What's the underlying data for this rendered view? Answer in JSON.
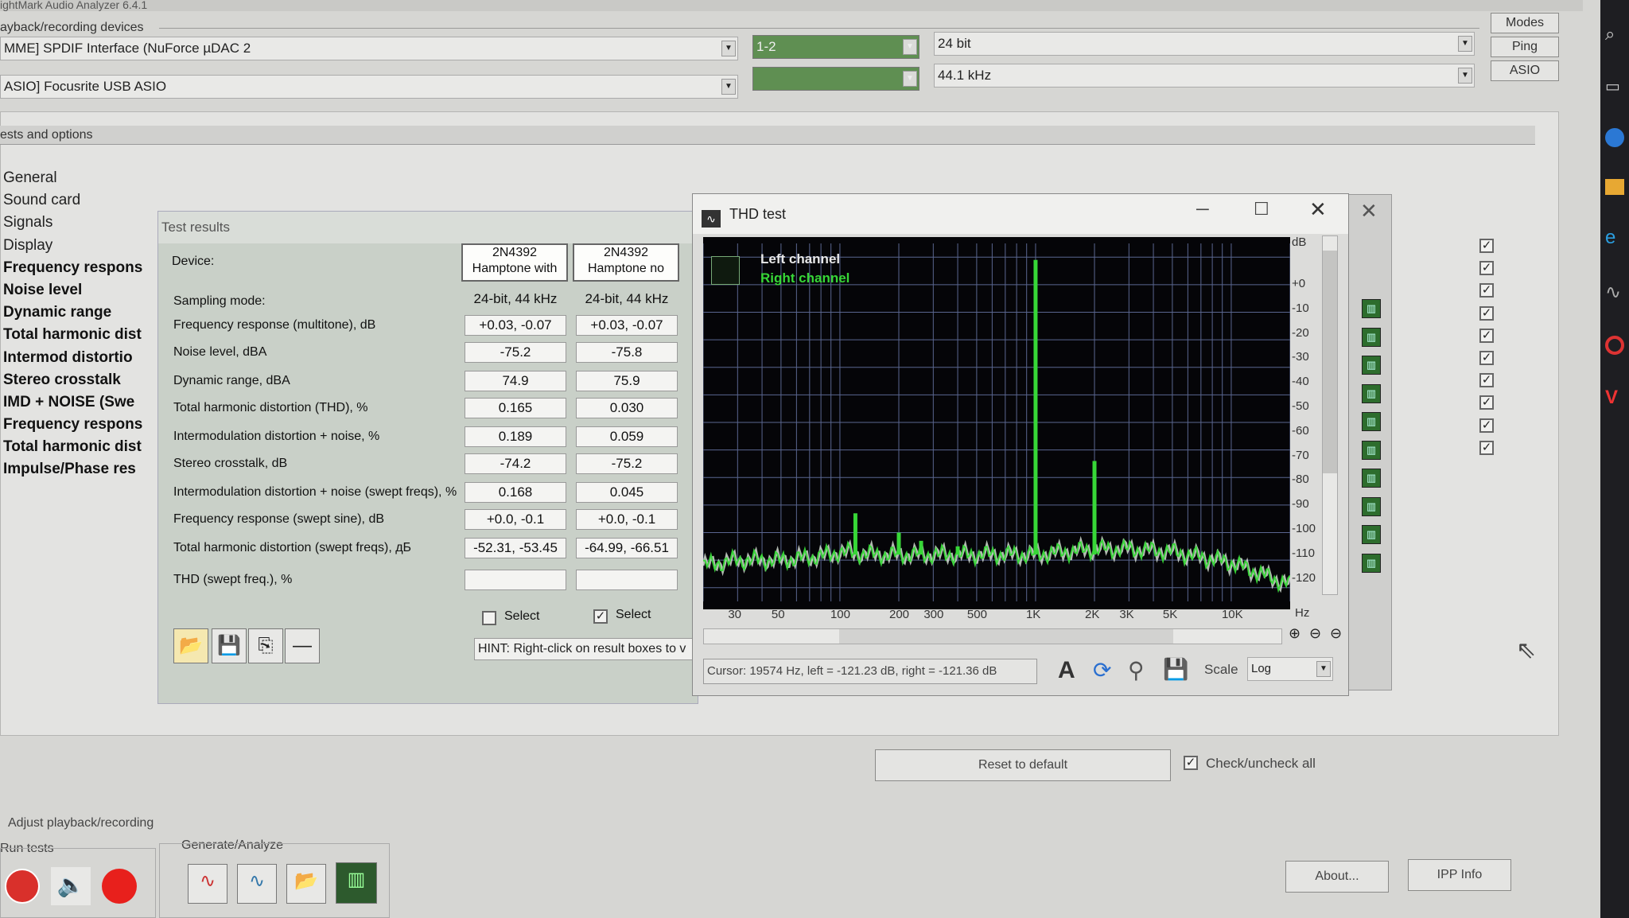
{
  "window": {
    "title": "ightMark Audio Analyzer 6.4.1"
  },
  "devices": {
    "group_label": "ayback/recording devices",
    "playback": "MME] SPDIF Interface (NuForce µDAC 2",
    "recording": "ASIO] Focusrite USB ASIO",
    "channels": "1-2",
    "bits": "24 bit",
    "rate": "44.1 kHz",
    "buttons": [
      "Modes",
      "Ping",
      "ASIO"
    ]
  },
  "options": {
    "group_label": "ests and options",
    "tree": [
      {
        "label": "General",
        "bold": false
      },
      {
        "label": "Sound card",
        "bold": false
      },
      {
        "label": "Signals",
        "bold": false
      },
      {
        "label": "Display",
        "bold": false
      },
      {
        "label": "Frequency respons",
        "bold": true
      },
      {
        "label": "Noise level",
        "bold": true
      },
      {
        "label": "Dynamic range",
        "bold": true
      },
      {
        "label": "Total harmonic dist",
        "bold": true
      },
      {
        "label": "Intermod distortio",
        "bold": true
      },
      {
        "label": "Stereo crosstalk",
        "bold": true
      },
      {
        "label": "IMD + NOISE (Swe",
        "bold": true
      },
      {
        "label": "Frequency respons",
        "bold": true
      },
      {
        "label": "Total harmonic dist",
        "bold": true
      },
      {
        "label": "Impulse/Phase res",
        "bold": true
      }
    ]
  },
  "results": {
    "title": "Test results",
    "device_label": "Device:",
    "devices": [
      {
        "line1": "2N4392",
        "line2": "Hamptone with"
      },
      {
        "line1": "2N4392",
        "line2": "Hamptone no"
      }
    ],
    "rows": [
      {
        "label": "Sampling mode:",
        "a": "24-bit, 44 kHz",
        "b": "24-bit, 44 kHz",
        "plain": true
      },
      {
        "label": "Frequency response (multitone), dB",
        "a": "+0.03, -0.07",
        "b": "+0.03, -0.07"
      },
      {
        "label": "Noise level, dBA",
        "a": "-75.2",
        "b": "-75.8"
      },
      {
        "label": "Dynamic range, dBA",
        "a": "74.9",
        "b": "75.9"
      },
      {
        "label": "Total harmonic distortion (THD), %",
        "a": "0.165",
        "b": "0.030"
      },
      {
        "label": "Intermodulation distortion + noise, %",
        "a": "0.189",
        "b": "0.059"
      },
      {
        "label": "Stereo crosstalk, dB",
        "a": "-74.2",
        "b": "-75.2"
      },
      {
        "label": "Intermodulation distortion + noise (swept freqs), %",
        "a": "0.168",
        "b": "0.045"
      },
      {
        "label": "Frequency response (swept sine), dB",
        "a": "+0.0, -0.1",
        "b": "+0.0, -0.1"
      },
      {
        "label": "Total harmonic distortion (swept freqs), дБ",
        "a": "-52.31, -53.45",
        "b": "-64.99, -66.51"
      },
      {
        "label": "THD (swept freq.), %",
        "a": "",
        "b": ""
      }
    ],
    "select_label": "Select",
    "hint": "HINT: Right-click on result boxes to v"
  },
  "thd": {
    "title": "THD test",
    "legend_left": "Left channel",
    "legend_right": "Right channel",
    "cursor": "Cursor:  19574 Hz,  left = -121.23 dB,  right = -121.36 dB",
    "scale_label": "Scale",
    "scale_value": "Log",
    "db_unit": "dB",
    "hz_unit": "Hz",
    "db_ticks": [
      "+0",
      "-10",
      "-20",
      "-30",
      "-40",
      "-50",
      "-60",
      "-70",
      "-80",
      "-90",
      "-100",
      "-110",
      "-120"
    ],
    "hz_ticks": [
      "30",
      "50",
      "100",
      "200",
      "300",
      "500",
      "1K",
      "2K",
      "3K",
      "5K",
      "10K"
    ]
  },
  "chart_data": {
    "type": "line",
    "title": "THD test",
    "xlabel": "Hz",
    "ylabel": "dB",
    "xscale": "log",
    "xlim": [
      20,
      20000
    ],
    "ylim": [
      -125,
      5
    ],
    "series": [
      {
        "name": "Left channel",
        "color": "#dfe8dd",
        "x": [
          20,
          30,
          50,
          70,
          90,
          100,
          150,
          200,
          300,
          500,
          1000,
          2000,
          3000,
          5000,
          10000,
          20000
        ],
        "values": [
          -112,
          -110,
          -110,
          -109,
          -108,
          -107,
          -108,
          -108,
          -108,
          -108,
          -108,
          -106,
          -106,
          -107,
          -111,
          -119
        ]
      },
      {
        "name": "Right channel",
        "color": "#37d737",
        "x": [
          20,
          30,
          50,
          70,
          90,
          100,
          150,
          200,
          300,
          500,
          1000,
          2000,
          3000,
          5000,
          10000,
          20000
        ],
        "values": [
          -112,
          -110,
          -110,
          -109,
          -108,
          -107,
          -108,
          -108,
          -108,
          -108,
          -108,
          -106,
          -106,
          -107,
          -111,
          -119
        ]
      }
    ],
    "peaks": [
      {
        "x": 1000,
        "y": -1
      },
      {
        "x": 2000,
        "y": -74
      },
      {
        "x": 120,
        "y": -93
      },
      {
        "x": 200,
        "y": -100
      },
      {
        "x": 260,
        "y": -103
      },
      {
        "x": 400,
        "y": -105
      }
    ]
  },
  "bottom": {
    "reset": "Reset to default",
    "check_all": "Check/uncheck all",
    "adjust": "Adjust playback/recording",
    "run_tests": "Run tests",
    "generate": "Generate/Analyze",
    "about": "About...",
    "ipp": "IPP Info"
  },
  "colors": {
    "accent": "#37d737",
    "trace": "#dfe8dd",
    "plot_bg": "#050508",
    "grid": "#5a6690"
  }
}
